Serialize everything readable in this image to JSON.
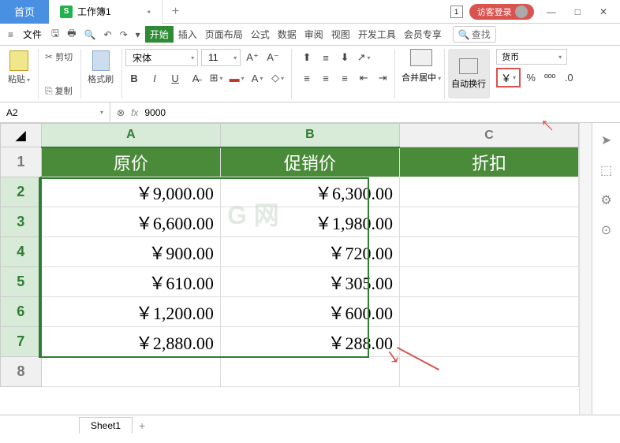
{
  "titlebar": {
    "home_tab": "首页",
    "doc_icon": "S",
    "doc_name": "工作簿1",
    "box_num": "1",
    "login": "访客登录"
  },
  "menu": {
    "file": "文件",
    "items": [
      "开始",
      "插入",
      "页面布局",
      "公式",
      "数据",
      "审阅",
      "视图",
      "开发工具",
      "会员专享"
    ],
    "search": "查找"
  },
  "ribbon": {
    "paste": "粘贴",
    "cut": "剪切",
    "copy": "复制",
    "format_painter": "格式刷",
    "font_name": "宋体",
    "font_size": "11",
    "merge": "合并居中",
    "wrap": "自动换行",
    "num_format": "货币",
    "currency": "￥"
  },
  "formula": {
    "cell_ref": "A2",
    "value": "9000"
  },
  "columns": [
    "A",
    "B",
    "C"
  ],
  "headers": {
    "a": "原价",
    "b": "促销价",
    "c": "折扣"
  },
  "rows": [
    {
      "a": "￥9,000.00",
      "b": "￥6,300.00"
    },
    {
      "a": "￥6,600.00",
      "b": "￥1,980.00"
    },
    {
      "a": "￥900.00",
      "b": "￥720.00"
    },
    {
      "a": "￥610.00",
      "b": "￥305.00"
    },
    {
      "a": "￥1,200.00",
      "b": "￥600.00"
    },
    {
      "a": "￥2,880.00",
      "b": "￥288.00"
    }
  ],
  "sheet_tab": "Sheet1",
  "watermark": "G  网"
}
